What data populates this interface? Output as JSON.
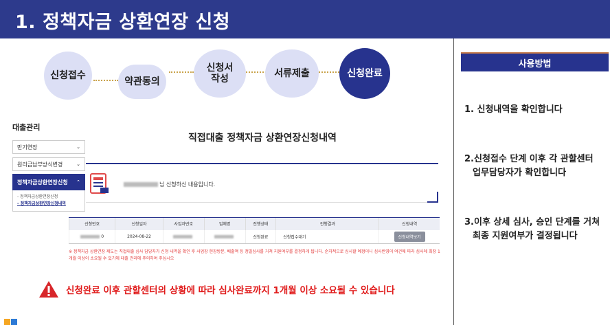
{
  "header": {
    "title": "1. 정책자금 상환연장 신청"
  },
  "steps": [
    {
      "label": "신청접수",
      "active": false
    },
    {
      "label": "약관동의",
      "active": false
    },
    {
      "label": "신청서\n작성",
      "line1": "신청서",
      "line2": "작성",
      "active": false
    },
    {
      "label": "서류제출",
      "active": false
    },
    {
      "label": "신청완료",
      "active": true
    }
  ],
  "sidebar": {
    "title": "대출관리",
    "items": [
      {
        "label": "만기연장"
      },
      {
        "label": "원리금납부방식변경"
      },
      {
        "label": "정책자금상환연장신청"
      }
    ],
    "subitems": [
      {
        "label": "- 정책자금상환연장신청"
      },
      {
        "label": "- 정책자금상환연장신청내역"
      }
    ]
  },
  "main": {
    "title": "직접대출 정책자금 상환연장신청내역",
    "notice": "님 신청하신 내용입니다.",
    "table": {
      "headers": [
        "신청번호",
        "신청일자",
        "사업자번호",
        "업체명",
        "진행상태",
        "진행결과",
        "신청내역"
      ],
      "row": {
        "apply_no_suffix": "0",
        "date": "2024-08-22",
        "status": "신청완료",
        "result": "신청접수대기",
        "button": "신청내역보기"
      }
    },
    "red_note": "※ 정책자금 상환연장 제도는 직접대출 심사 담당자가 신청 내역을 확인 후 사업장 현장방문, 배출액 등 정밀심사를 거쳐 지원여부를 결정하게 됩니다. 순차적으로 심사할 예정이니 심사반영이 여건에 따라 심사에 최장 1개월 이상이 소요될 수 있기에 대출 관리에 주의하여 주십시오",
    "warning": "신청완료 이후 관할센터의 상황에 따라 심사완료까지 1개월 이상 소요될 수 있습니다"
  },
  "howto": {
    "title": "사용방법",
    "items": [
      {
        "line1": "1. 신청내역을 확인합니다",
        "line2": ""
      },
      {
        "line1": "2.신청접수 단계 이후 각 관할센터",
        "line2": "업무담당자가 확인합니다"
      },
      {
        "line1": "3.이후 상세 심사, 승인 단계를 거쳐",
        "line2": "최종 지원여부가 결정됩니다"
      }
    ]
  },
  "colors": {
    "primary": "#27338e",
    "header": "#2d3a8c",
    "step_light": "#dcdff5",
    "warning": "#e01b1b",
    "accent_line": "#c67b4a"
  },
  "icons": [
    "document-icon",
    "warning-triangle-icon",
    "chevron-down-icon",
    "chevron-up-icon",
    "logo"
  ]
}
